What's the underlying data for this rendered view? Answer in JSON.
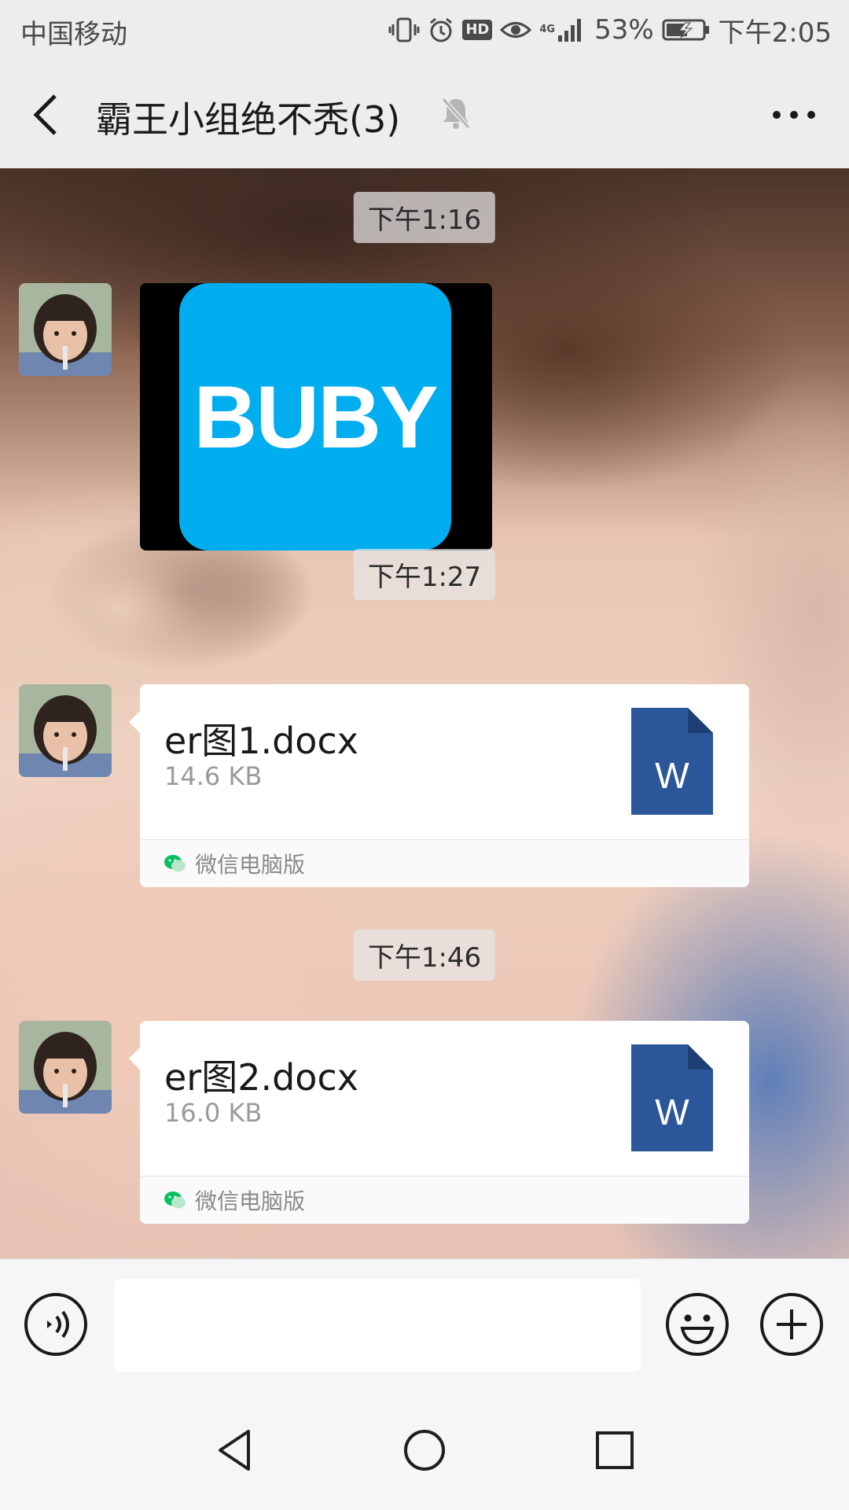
{
  "status_bar": {
    "carrier": "中国移动",
    "hd": "HD",
    "network": "4G",
    "battery_percent": "53%",
    "time": "下午2:05"
  },
  "header": {
    "title": "霸王小组绝不秃(3)",
    "muted": true
  },
  "messages": [
    {
      "type": "timestamp",
      "text": "下午1:16"
    },
    {
      "type": "image",
      "sender": "member-avatar",
      "image_text": "BUBY",
      "image_bg": "#00aeef"
    },
    {
      "type": "timestamp",
      "text": "下午1:27"
    },
    {
      "type": "file",
      "sender": "member-avatar",
      "file_name": "er图1.docx",
      "file_size": "14.6 KB",
      "file_icon_letter": "W",
      "source": "微信电脑版"
    },
    {
      "type": "timestamp",
      "text": "下午1:46"
    },
    {
      "type": "file",
      "sender": "member-avatar",
      "file_name": "er图2.docx",
      "file_size": "16.0 KB",
      "file_icon_letter": "W",
      "source": "微信电脑版"
    }
  ],
  "input_bar": {
    "message_value": ""
  },
  "icons": {
    "back": "chevron-left-icon",
    "mute": "bell-off-icon",
    "more": "more-dots-icon",
    "voice": "voice-icon",
    "emoji": "smiley-icon",
    "plus": "plus-circle-icon",
    "word": "word-doc-icon"
  },
  "colors": {
    "word_blue": "#2b579a",
    "wechat_green": "#07c160",
    "logo_blue": "#00aeef"
  }
}
